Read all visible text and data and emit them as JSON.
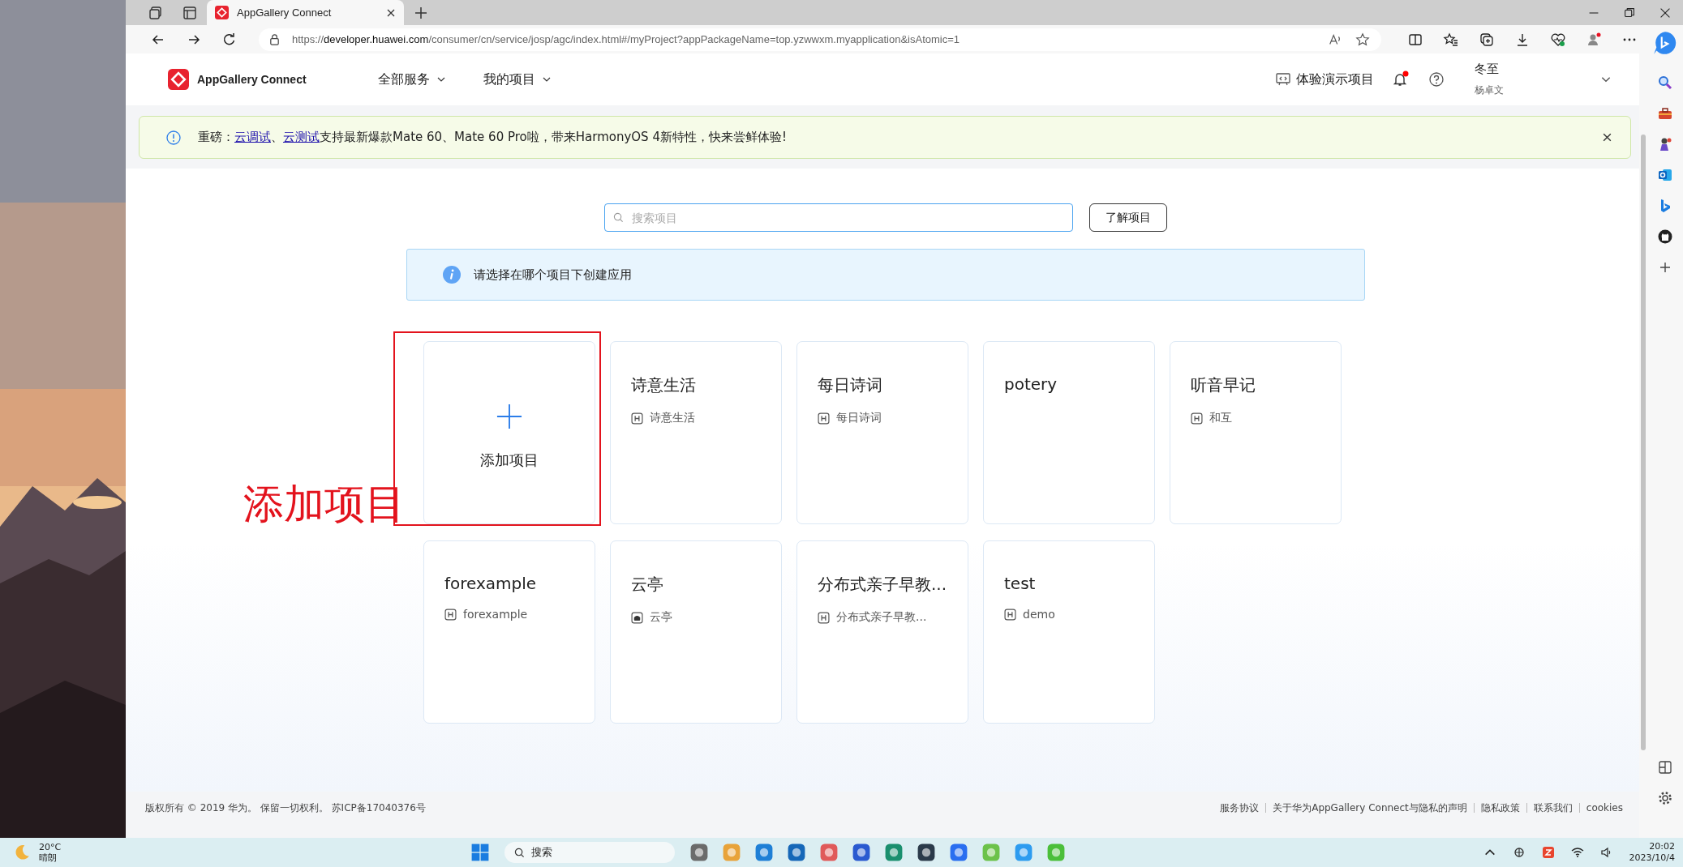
{
  "browser": {
    "tabs": [
      {
        "title": "AppGallery Connect",
        "selected": true
      }
    ],
    "url": {
      "scheme": "https://",
      "host": "developer.huawei.com",
      "path": "/consumer/cn/service/josp/agc/index.html#/myProject?appPackageName=top.yzwwxm.myapplication&isAtomic=1"
    },
    "profile_alert": true
  },
  "header": {
    "brand": "AppGallery Connect",
    "nav": [
      {
        "label": "全部服务"
      },
      {
        "label": "我的项目"
      }
    ],
    "demo": "体验演示项目",
    "unread": true,
    "user": {
      "name": "冬至",
      "account": "杨卓文"
    }
  },
  "banner": {
    "parts": [
      {
        "kind": "text",
        "text": "重磅："
      },
      {
        "kind": "link",
        "text": "云调试"
      },
      {
        "kind": "text",
        "text": "、"
      },
      {
        "kind": "link",
        "text": "云测试"
      },
      {
        "kind": "text",
        "text": "支持最新爆款Mate 60、Mate 60 Pro啦，带来HarmonyOS 4新特性，快来尝鲜体验!"
      }
    ]
  },
  "search": {
    "placeholder": "搜索项目"
  },
  "learn_button": "了解项目",
  "info": "请选择在哪个项目下创建应用",
  "add_card": "添加项目",
  "projects": [
    {
      "name": "诗意生活",
      "kind": "harmony",
      "app": "诗意生活"
    },
    {
      "name": "每日诗词",
      "kind": "harmony",
      "app": "每日诗词"
    },
    {
      "name": "potery",
      "kind": "none"
    },
    {
      "name": "听音早记",
      "kind": "harmony",
      "app": "和互"
    },
    {
      "name": "forexample",
      "kind": "harmony",
      "app": "forexample"
    },
    {
      "name": "云亭",
      "kind": "android",
      "app": "云亭"
    },
    {
      "name": "分布式亲子早教...",
      "kind": "harmony",
      "app": "分布式亲子早教..."
    },
    {
      "name": "test",
      "kind": "harmony",
      "app": "demo"
    }
  ],
  "annotation": "添加项目",
  "footer": {
    "copyright": "版权所有 © 2019 华为。 保留一切权利。 苏ICP备17040376号",
    "links": [
      "服务协议",
      "关于华为AppGallery Connect与隐私的声明",
      "隐私政策",
      "联系我们",
      "cookies"
    ]
  },
  "taskbar": {
    "temperature": "20°C",
    "weather": "晴朗",
    "search": "搜索",
    "time": "20:02",
    "date": "2023/10/4"
  }
}
